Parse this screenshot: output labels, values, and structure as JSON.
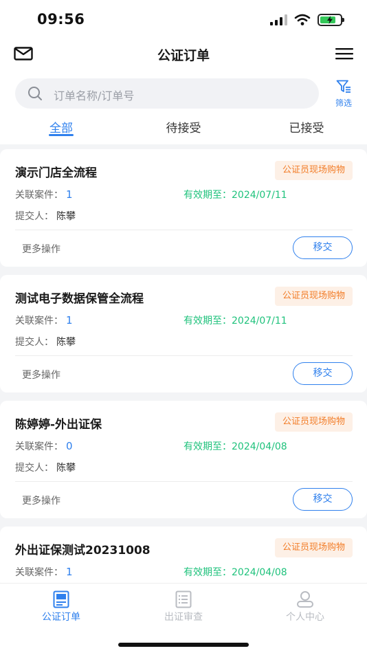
{
  "status_bar": {
    "time": "09:56"
  },
  "header": {
    "title": "公证订单"
  },
  "search": {
    "placeholder": "订单名称/订单号"
  },
  "filter": {
    "label": "筛选"
  },
  "tabs": [
    {
      "label": "全部",
      "active": true
    },
    {
      "label": "待接受",
      "active": false
    },
    {
      "label": "已接受",
      "active": false
    }
  ],
  "labels": {
    "cases": "关联案件：",
    "valid_until": "有效期至：",
    "submitter": "提交人：",
    "more_actions": "更多操作",
    "transfer": "移交"
  },
  "orders": [
    {
      "title": "演示门店全流程",
      "badge": "公证员现场购物",
      "cases": "1",
      "valid_until": "2024/07/11",
      "submitter": "陈攀"
    },
    {
      "title": "测试电子数据保管全流程",
      "badge": "公证员现场购物",
      "cases": "1",
      "valid_until": "2024/07/11",
      "submitter": "陈攀"
    },
    {
      "title": "陈婷婷-外出证保",
      "badge": "公证员现场购物",
      "cases": "0",
      "valid_until": "2024/04/08",
      "submitter": "陈攀"
    },
    {
      "title": "外出证保测试20231008",
      "badge": "公证员现场购物",
      "cases": "1",
      "valid_until": "2024/04/08",
      "submitter": ""
    }
  ],
  "bottom_nav": [
    {
      "label": "公证订单",
      "icon": "document-icon",
      "active": true
    },
    {
      "label": "出证审查",
      "icon": "list-icon",
      "active": false
    },
    {
      "label": "个人中心",
      "icon": "user-icon",
      "active": false
    }
  ],
  "colors": {
    "accent": "#2f80ed",
    "valid": "#1fc27c",
    "badge_text": "#f27d28",
    "badge_bg": "#fdf0e6"
  }
}
